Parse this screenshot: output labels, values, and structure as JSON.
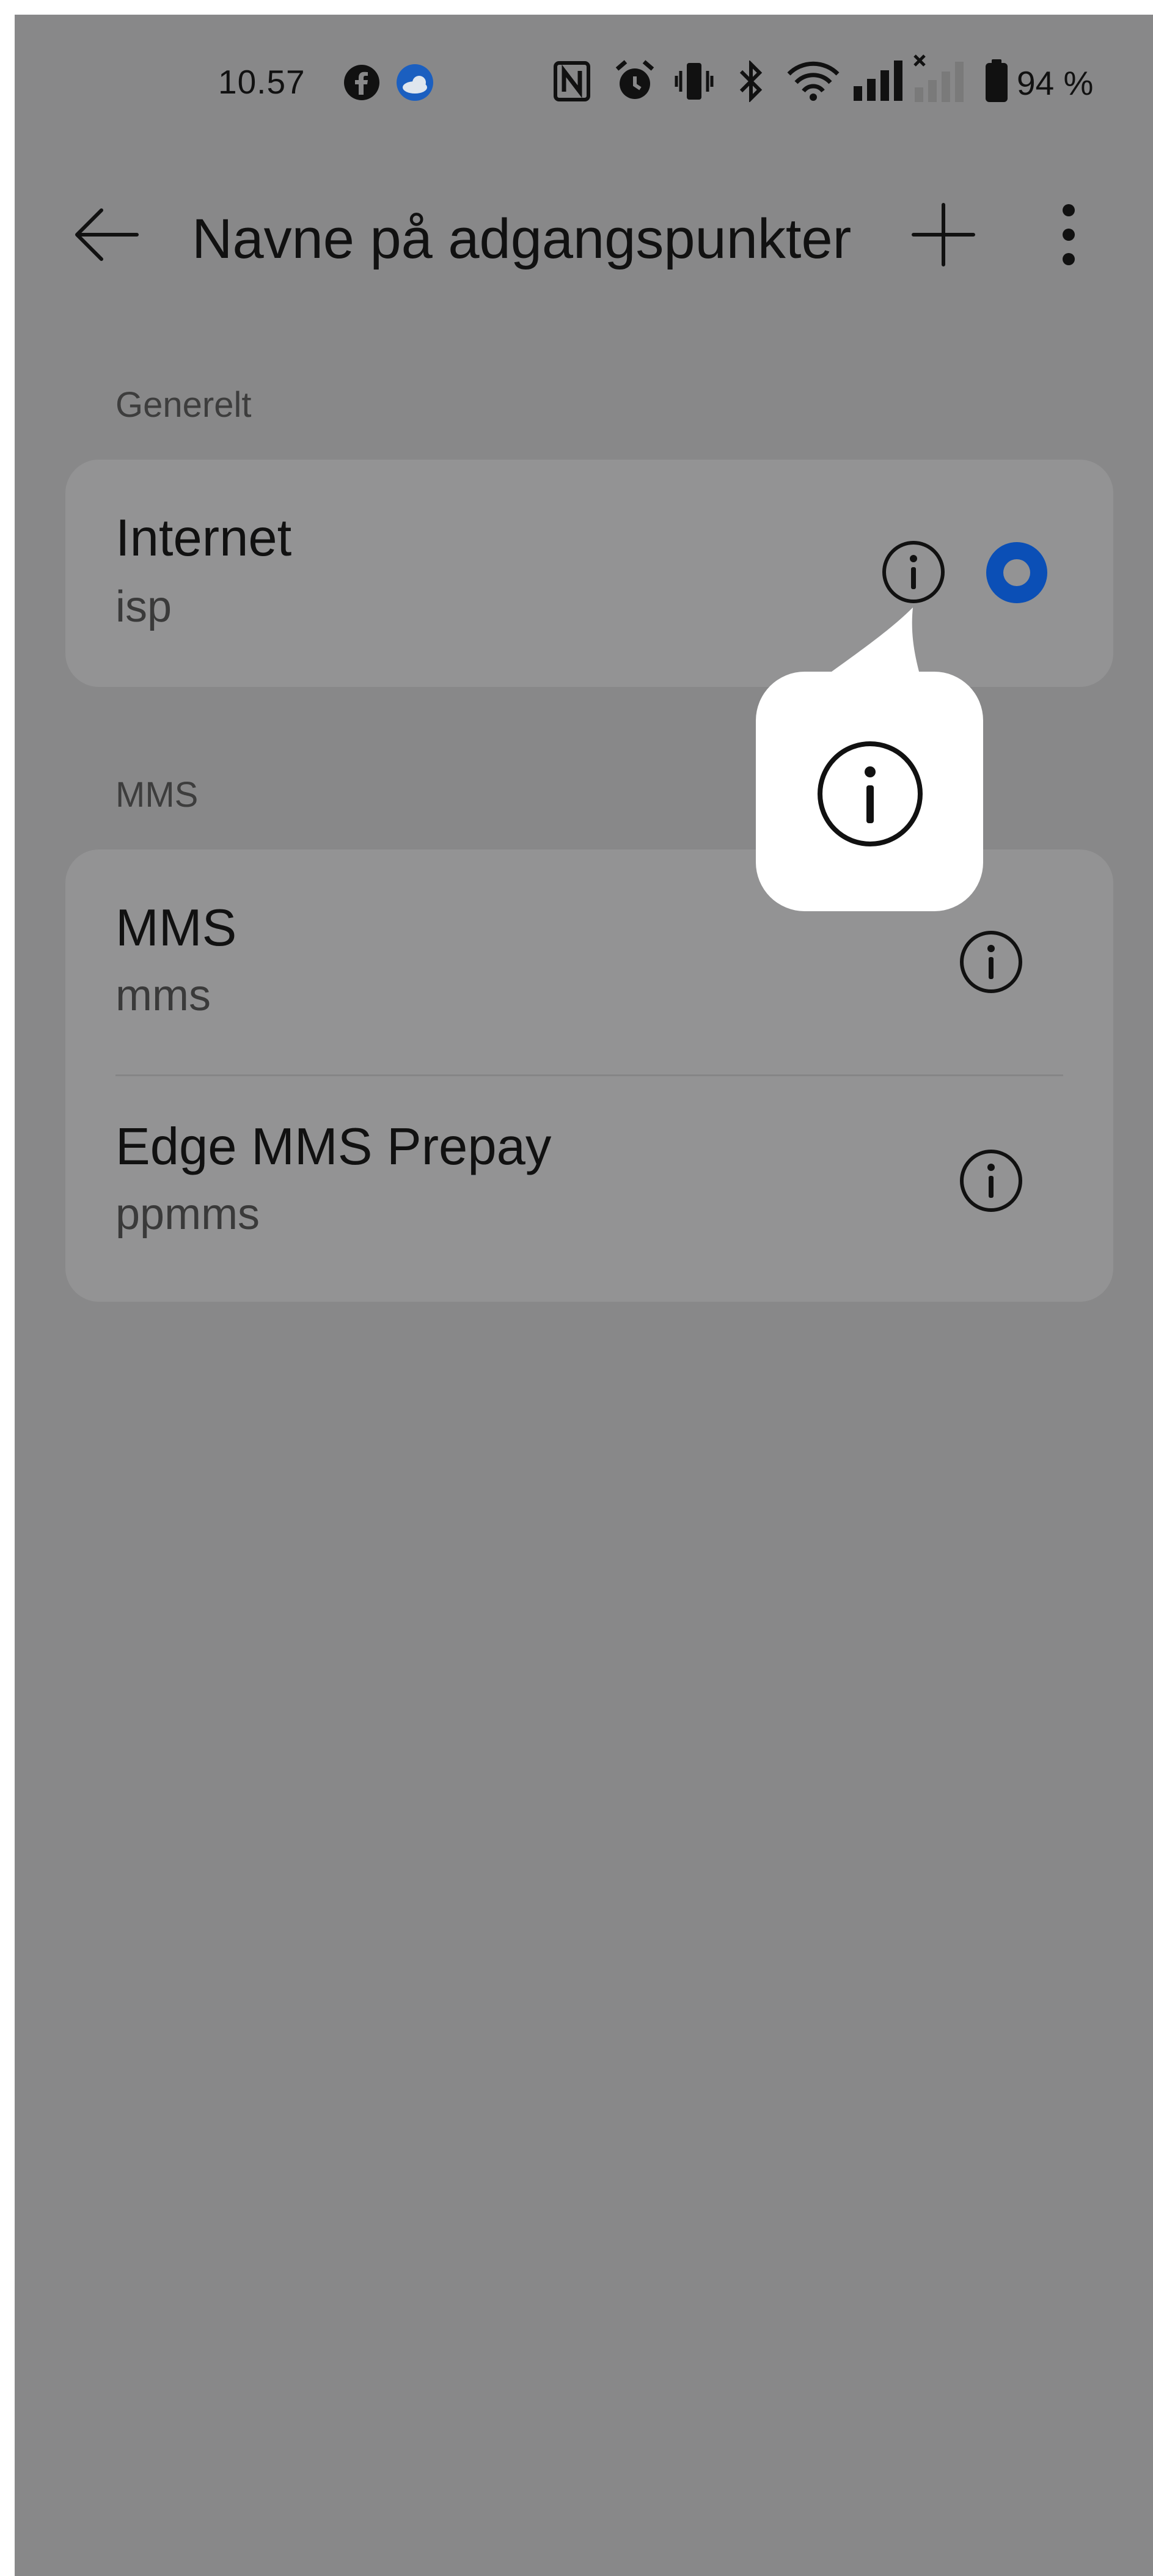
{
  "status_bar": {
    "time": "10.57",
    "battery": "94 %",
    "icons": [
      "facebook-icon",
      "weather-icon",
      "nfc-icon",
      "alarm-icon",
      "vibrate-icon",
      "bluetooth-icon",
      "wifi-icon",
      "signal-icon",
      "signal-no-sim-icon",
      "battery-icon"
    ]
  },
  "app_bar": {
    "title": "Navne på adgangspunkter",
    "back_icon": "arrow-left-icon",
    "add_icon": "plus-icon",
    "more_icon": "more-vertical-icon"
  },
  "sections": [
    {
      "header": "Generelt",
      "items": [
        {
          "title": "Internet",
          "subtitle": "isp",
          "selected": true
        }
      ]
    },
    {
      "header": "MMS",
      "items": [
        {
          "title": "MMS",
          "subtitle": "mms",
          "selected": false
        },
        {
          "title": "Edge MMS Prepay",
          "subtitle": "ppmms",
          "selected": false
        }
      ]
    }
  ],
  "colors": {
    "overlay_background": "#888889",
    "card_background": "#939394",
    "radio_selected": "#0b4fb6",
    "callout_background": "#ffffff"
  },
  "callout": {
    "icon": "info-icon"
  }
}
